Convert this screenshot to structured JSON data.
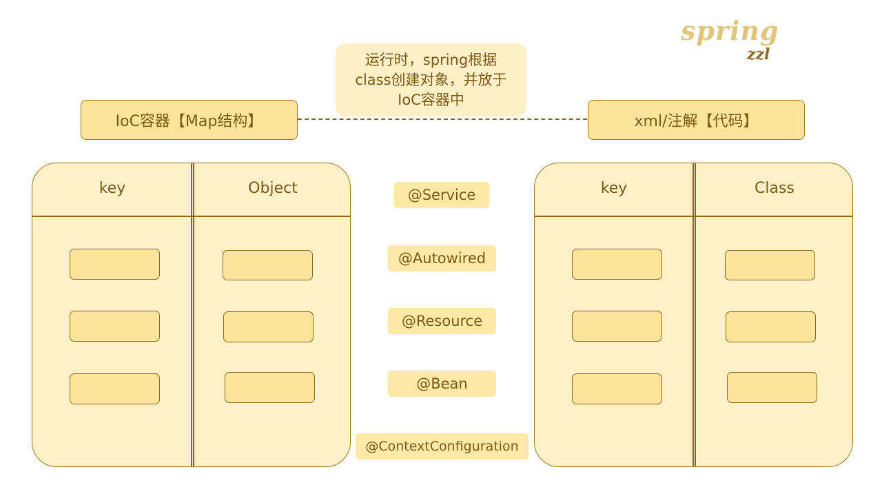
{
  "logo": {
    "main": "spring",
    "sub": "zzl"
  },
  "note": {
    "lines": [
      "运行时，spring根据",
      "class创建对象，并放于",
      "IoC容器中"
    ]
  },
  "left_title": "IoC容器【Map结构】",
  "right_title": "xml/注解【代码】",
  "left_panel": {
    "col1": "key",
    "col2": "Object"
  },
  "right_panel": {
    "col1": "key",
    "col2": "Class"
  },
  "annotations": [
    "@Service",
    "@Autowired",
    "@Resource",
    "@Bean",
    "@ContextConfiguration"
  ],
  "colors": {
    "fill": "#fde49c",
    "panel": "#fef0c8",
    "stroke": "#8a6a1e",
    "text": "#7a5a14"
  }
}
